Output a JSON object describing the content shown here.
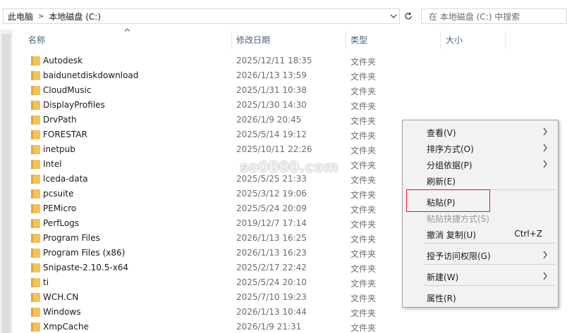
{
  "address": {
    "crumbs": [
      "此电脑",
      "本地磁盘 (C:)"
    ],
    "separator": ">"
  },
  "search": {
    "placeholder": "在 本地磁盘 (C:) 中搜索"
  },
  "columns": {
    "name": "名称",
    "date": "修改日期",
    "type": "类型",
    "size": "大小"
  },
  "files": [
    {
      "name": "Autodesk",
      "date": "2025/12/11 18:35",
      "type": "文件夹"
    },
    {
      "name": "baidunetdiskdownload",
      "date": "2026/1/13 13:59",
      "type": "文件夹"
    },
    {
      "name": "CloudMusic",
      "date": "2025/1/31 10:38",
      "type": "文件夹"
    },
    {
      "name": "DisplayProfiles",
      "date": "2025/1/30 14:30",
      "type": "文件夹"
    },
    {
      "name": "DrvPath",
      "date": "2026/1/9 20:45",
      "type": "文件夹"
    },
    {
      "name": "FORESTAR",
      "date": "2025/5/14 19:12",
      "type": "文件夹"
    },
    {
      "name": "inetpub",
      "date": "2025/10/11 22:26",
      "type": "文件夹"
    },
    {
      "name": "Intel",
      "date": "",
      "type": "文件夹"
    },
    {
      "name": "lceda-data",
      "date": "2025/5/25 21:33",
      "type": "文件夹"
    },
    {
      "name": "pcsuite",
      "date": "2025/3/12 19:06",
      "type": "文件夹"
    },
    {
      "name": "PEMicro",
      "date": "2025/5/24 20:09",
      "type": "文件夹"
    },
    {
      "name": "PerfLogs",
      "date": "2019/12/7 17:14",
      "type": "文件夹"
    },
    {
      "name": "Program Files",
      "date": "2026/1/13 16:25",
      "type": "文件夹"
    },
    {
      "name": "Program Files (x86)",
      "date": "2026/1/13 16:23",
      "type": "文件夹"
    },
    {
      "name": "Snipaste-2.10.5-x64",
      "date": "2025/2/17 22:42",
      "type": "文件夹"
    },
    {
      "name": "ti",
      "date": "2025/5/24 20:10",
      "type": "文件夹"
    },
    {
      "name": "WCH.CN",
      "date": "2025/7/10 19:23",
      "type": "文件夹"
    },
    {
      "name": "Windows",
      "date": "2026/1/13 10:44",
      "type": "文件夹"
    },
    {
      "name": "XmpCache",
      "date": "2026/1/9 21:31",
      "type": "文件夹"
    }
  ],
  "watermark": "so0000.com",
  "context_menu": {
    "view": "查看(V)",
    "sort": "排序方式(O)",
    "group": "分组依据(P)",
    "refresh": "刷新(E)",
    "paste": "粘贴(P)",
    "paste_shortcut": "粘贴快捷方式(S)",
    "undo": "撤消 复制(U)",
    "undo_shortcut": "Ctrl+Z",
    "grant_access": "授予访问权限(G)",
    "new": "新建(W)",
    "properties": "属性(R)"
  },
  "colors": {
    "folder": "#f4c25a",
    "folder_tab": "#e0a83a",
    "highlight": "#e81123",
    "header_text": "#4c607a"
  }
}
